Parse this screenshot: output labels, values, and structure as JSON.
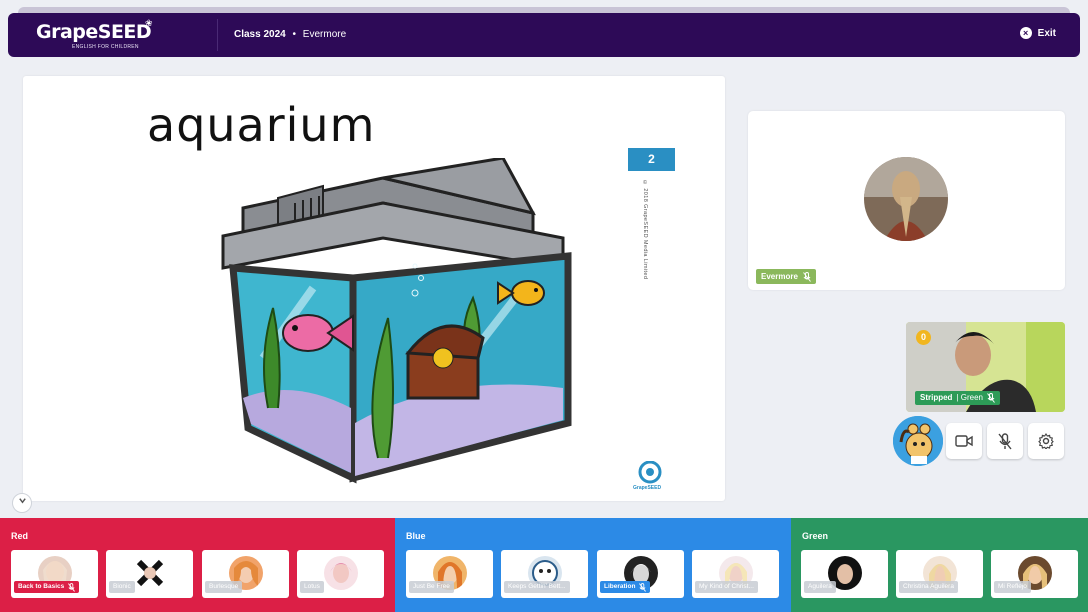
{
  "header": {
    "logo_text": "GrapeSEED",
    "logo_sub": "ENGLISH FOR CHILDREN",
    "class_name": "Class 2024",
    "separator": "•",
    "room_name": "Evermore",
    "exit_label": "Exit"
  },
  "slide": {
    "word": "aquarium",
    "page_number": "2",
    "copyright": "© 2018 GrapeSEED Media Limited",
    "logo_text": "GrapeSEED"
  },
  "teacher": {
    "name": "Evermore"
  },
  "self_view": {
    "coins": "0",
    "name": "Stripped",
    "team": "| Green"
  },
  "teams": [
    {
      "name": "Red",
      "color": "#dc1f46",
      "students": [
        {
          "name": "Back to Basics",
          "active": true
        },
        {
          "name": "Bionic",
          "active": false
        },
        {
          "name": "Burlesque",
          "active": false
        },
        {
          "name": "Lotus",
          "active": false
        }
      ]
    },
    {
      "name": "Blue",
      "color": "#2c8ae6",
      "students": [
        {
          "name": "Just Be Free",
          "active": false
        },
        {
          "name": "Keeps Gettin' Bett...",
          "active": false
        },
        {
          "name": "Liberation",
          "active": true
        },
        {
          "name": "My Kind of Christ...",
          "active": false
        }
      ]
    },
    {
      "name": "Green",
      "color": "#2a9761",
      "students": [
        {
          "name": "Aguilera",
          "active": false
        },
        {
          "name": "Christina Aguilera",
          "active": false
        },
        {
          "name": "Mi Reflejo",
          "active": false
        }
      ]
    }
  ],
  "icons": {
    "exit": "close-circle-icon",
    "video": "video-camera-icon",
    "mic": "microphone-muted-icon",
    "settings": "gear-icon",
    "collapse": "chevron-down-icon"
  },
  "colors": {
    "header_bg": "#2d0a57",
    "teacher_tag": "#8bb85c",
    "self_tag": "#2d9b57",
    "coin": "#f1b61f",
    "page_box": "#2a8fc3"
  }
}
